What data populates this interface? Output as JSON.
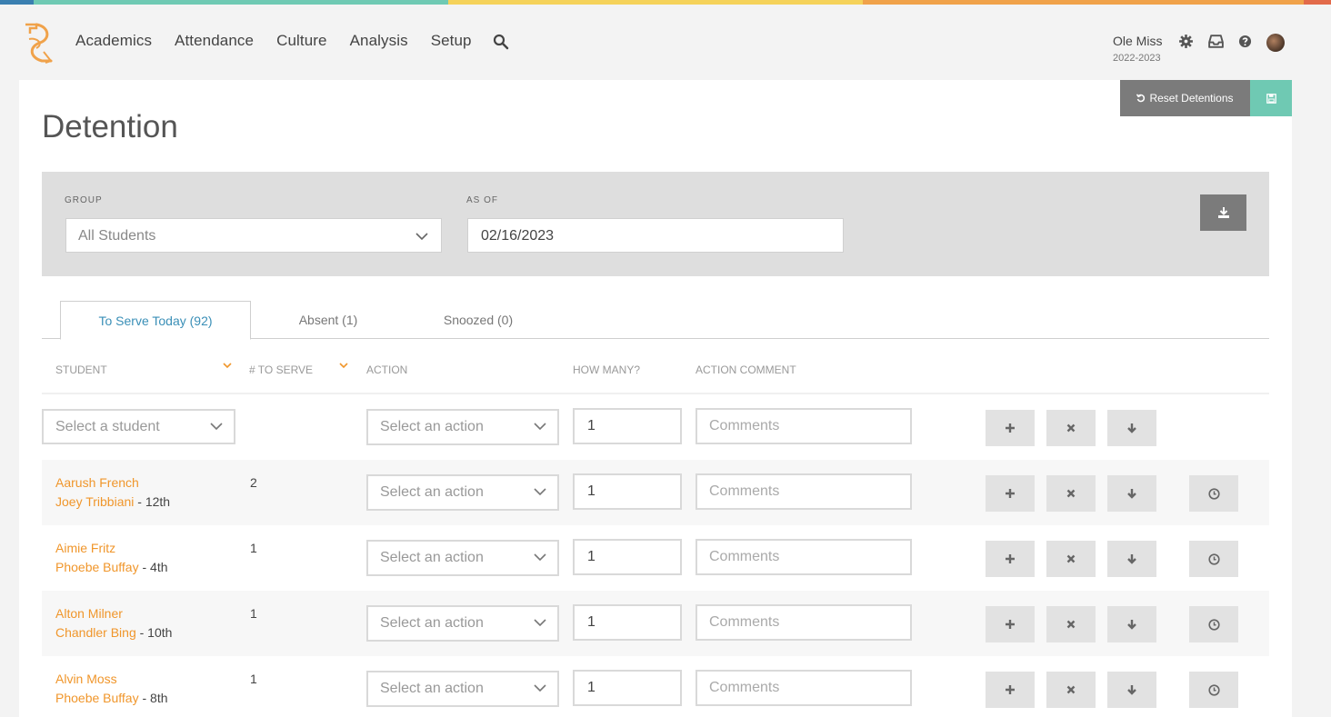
{
  "colors": {
    "stripe": [
      "#3a7fb0",
      "#6fc9b3",
      "#f5d25a",
      "#f0a24a",
      "#e26a4a"
    ],
    "accent_orange": "#f0962b",
    "accent_blue": "#3a8fb7",
    "save_green": "#6fc9b3"
  },
  "nav": {
    "items": [
      "Academics",
      "Attendance",
      "Culture",
      "Analysis",
      "Setup"
    ],
    "school": "Ole Miss",
    "year": "2022-2023"
  },
  "toolbar": {
    "reset_label": "Reset Detentions"
  },
  "page": {
    "title": "Detention"
  },
  "filters": {
    "group_label": "GROUP",
    "group_value": "All Students",
    "asof_label": "AS OF",
    "asof_value": "02/16/2023"
  },
  "tabs": [
    {
      "label": "To Serve Today (92)"
    },
    {
      "label": "Absent (1)"
    },
    {
      "label": "Snoozed (0)"
    }
  ],
  "columns": {
    "student": "STUDENT",
    "to_serve": "# TO SERVE",
    "action": "ACTION",
    "how_many": "HOW MANY?",
    "comment": "ACTION COMMENT"
  },
  "new_row": {
    "student_placeholder": "Select a student",
    "action_placeholder": "Select an action",
    "how_many": "1",
    "comment_placeholder": "Comments"
  },
  "rows": [
    {
      "student": "Aarush French",
      "teacher": "Joey Tribbiani",
      "grade": " - 12th",
      "count": "2",
      "action_placeholder": "Select an action",
      "how_many": "1",
      "comment_placeholder": "Comments"
    },
    {
      "student": "Aimie Fritz",
      "teacher": "Phoebe Buffay",
      "grade": " - 4th",
      "count": "1",
      "action_placeholder": "Select an action",
      "how_many": "1",
      "comment_placeholder": "Comments"
    },
    {
      "student": "Alton Milner",
      "teacher": "Chandler Bing",
      "grade": " - 10th",
      "count": "1",
      "action_placeholder": "Select an action",
      "how_many": "1",
      "comment_placeholder": "Comments"
    },
    {
      "student": "Alvin Moss",
      "teacher": "Phoebe Buffay",
      "grade": " - 8th",
      "count": "1",
      "action_placeholder": "Select an action",
      "how_many": "1",
      "comment_placeholder": "Comments"
    }
  ]
}
